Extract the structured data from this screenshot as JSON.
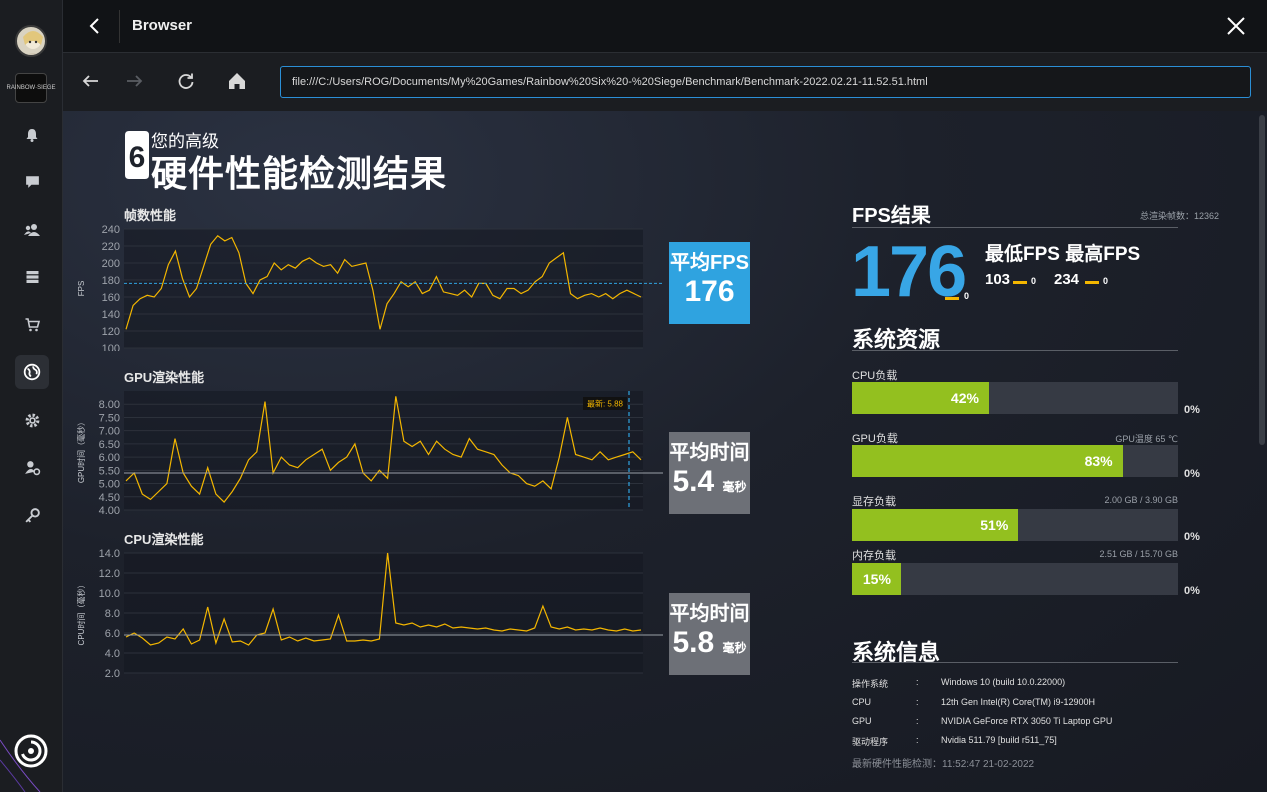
{
  "window": {
    "title": "Browser"
  },
  "nav": {
    "url": "file:///C:/Users/ROG/Documents/My%20Games/Rainbow%20Six%20-%20Siege/Benchmark/Benchmark-2022.02.21-11.52.51.html"
  },
  "sidebar": {
    "game_tile": "RAINBOW·SIEGE",
    "icons": [
      "notifications-icon",
      "chat-icon",
      "friends-icon",
      "library-icon",
      "store-icon",
      "web-icon",
      "settings-icon",
      "account-settings-icon",
      "key-icon"
    ]
  },
  "header": {
    "badge": "6",
    "small": "您的高级",
    "big": "硬件性能检测结果"
  },
  "fps_chart": {
    "label": "帧数性能",
    "ylabel": "FPS",
    "avg_title": "平均FPS",
    "avg_value": "176",
    "box_color": "#2fa3e0"
  },
  "gpu_chart": {
    "label": "GPU渲染性能",
    "ylabel": "GPU时间（毫秒）",
    "latest_label": "最新: 5.88",
    "avg_title": "平均时间",
    "avg_value": "5.4",
    "avg_unit": "毫秒"
  },
  "cpu_chart": {
    "label": "CPU渲染性能",
    "ylabel": "CPU时间（毫秒）",
    "avg_title": "平均时间",
    "avg_value": "5.8",
    "avg_unit": "毫秒"
  },
  "chart_data": [
    {
      "type": "line",
      "title": "帧数性能",
      "ylabel": "FPS",
      "ylim": [
        100,
        240
      ],
      "yticks": [
        "240",
        "220",
        "200",
        "180",
        "160",
        "140",
        "120",
        "100"
      ],
      "avg": 176,
      "series": [
        {
          "values": [
            122,
            150,
            158,
            162,
            160,
            170,
            198,
            214,
            182,
            160,
            170,
            196,
            222,
            232,
            226,
            230,
            212,
            176,
            164,
            180,
            184,
            200,
            192,
            198,
            194,
            202,
            206,
            200,
            196,
            198,
            188,
            204,
            196,
            198,
            200,
            168,
            122,
            152,
            164,
            178,
            172,
            178,
            164,
            168,
            184,
            166,
            164,
            162,
            168,
            160,
            176,
            176,
            162,
            158,
            170,
            170,
            164,
            168,
            178,
            184,
            200,
            206,
            212,
            164,
            158,
            162,
            164,
            160,
            164,
            158,
            164,
            168,
            164,
            160
          ]
        }
      ]
    },
    {
      "type": "line",
      "title": "GPU渲染性能",
      "ylabel": "GPU时间（毫秒）",
      "ylim": [
        4.0,
        8.5
      ],
      "yticks": [
        "8.00",
        "7.50",
        "7.00",
        "6.50",
        "6.00",
        "5.50",
        "5.00",
        "4.50",
        "4.00"
      ],
      "avg": 5.4,
      "latest": 5.88,
      "series": [
        {
          "values": [
            5.1,
            5.4,
            4.6,
            4.4,
            4.7,
            5.0,
            6.7,
            5.4,
            4.9,
            4.6,
            5.6,
            4.6,
            4.3,
            4.7,
            5.2,
            5.9,
            6.2,
            8.1,
            5.4,
            6.0,
            5.7,
            5.6,
            5.9,
            6.1,
            6.3,
            5.5,
            5.8,
            6.0,
            6.5,
            5.4,
            5.1,
            5.5,
            5.2,
            8.3,
            6.6,
            6.4,
            6.6,
            6.1,
            6.6,
            6.3,
            6.1,
            6.0,
            6.7,
            6.3,
            6.2,
            6.1,
            5.7,
            5.4,
            5.3,
            5.0,
            4.9,
            5.1,
            4.8,
            6.0,
            7.5,
            6.1,
            6.0,
            5.9,
            6.2,
            5.9,
            6.0,
            6.1,
            6.2,
            5.9
          ]
        }
      ]
    },
    {
      "type": "line",
      "title": "CPU渲染性能",
      "ylabel": "CPU时间（毫秒）",
      "ylim": [
        2.0,
        14.0
      ],
      "yticks": [
        "14.0",
        "12.0",
        "10.0",
        "8.0",
        "6.0",
        "4.0",
        "2.0"
      ],
      "avg": 5.8,
      "series": [
        {
          "values": [
            5.6,
            6.0,
            5.5,
            4.8,
            5.0,
            5.6,
            5.4,
            6.4,
            4.9,
            5.3,
            8.6,
            5.0,
            7.4,
            5.1,
            5.2,
            4.8,
            5.8,
            6.0,
            8.4,
            5.3,
            5.6,
            5.2,
            5.5,
            5.2,
            5.3,
            5.4,
            7.8,
            5.2,
            5.2,
            5.3,
            5.2,
            5.4,
            14.0,
            7.0,
            6.8,
            7.0,
            6.6,
            6.8,
            6.6,
            6.9,
            6.5,
            6.6,
            6.5,
            6.4,
            6.5,
            6.3,
            6.2,
            6.4,
            6.3,
            6.2,
            6.5,
            8.7,
            6.6,
            6.4,
            6.6,
            6.3,
            6.4,
            6.3,
            6.5,
            6.3,
            6.2,
            6.4,
            6.2,
            6.3
          ]
        }
      ]
    }
  ],
  "fps_result": {
    "title": "FPS结果",
    "total_frames": "总渲染帧数：12362",
    "avg": "176",
    "avg_sub": "0",
    "minmax_label": "最低FPS 最高FPS",
    "min": "103",
    "min_sub": "0",
    "max": "234",
    "max_sub": "0",
    "accent": "#f3b600"
  },
  "resources": {
    "title": "系统资源",
    "bar_color": "#93c01f",
    "items": [
      {
        "label": "CPU负载",
        "right": "",
        "pct": 42,
        "pct_text": "42%",
        "zero": "0%"
      },
      {
        "label": "GPU负载",
        "right": "GPU温度 65 ℃",
        "pct": 83,
        "pct_text": "83%",
        "zero": "0%"
      },
      {
        "label": "显存负载",
        "right": "2.00 GB / 3.90 GB",
        "pct": 51,
        "pct_text": "51%",
        "zero": "0%"
      },
      {
        "label": "内存负载",
        "right": "2.51 GB / 15.70 GB",
        "pct": 15,
        "pct_text": "15%",
        "zero": "0%"
      }
    ]
  },
  "sysinfo": {
    "title": "系统信息",
    "rows": [
      {
        "k": "操作系统",
        "c": ":",
        "v": "Windows 10 (build 10.0.22000)"
      },
      {
        "k": "CPU",
        "c": ":",
        "v": "12th Gen Intel(R) Core(TM) i9-12900H"
      },
      {
        "k": "GPU",
        "c": ":",
        "v": "NVIDIA GeForce RTX 3050 Ti Laptop GPU"
      },
      {
        "k": "驱动程序",
        "c": ":",
        "v": "Nvidia 511.79 [build r511_75]"
      }
    ],
    "footer": "最新硬件性能检测：11:52:47 21-02-2022"
  }
}
